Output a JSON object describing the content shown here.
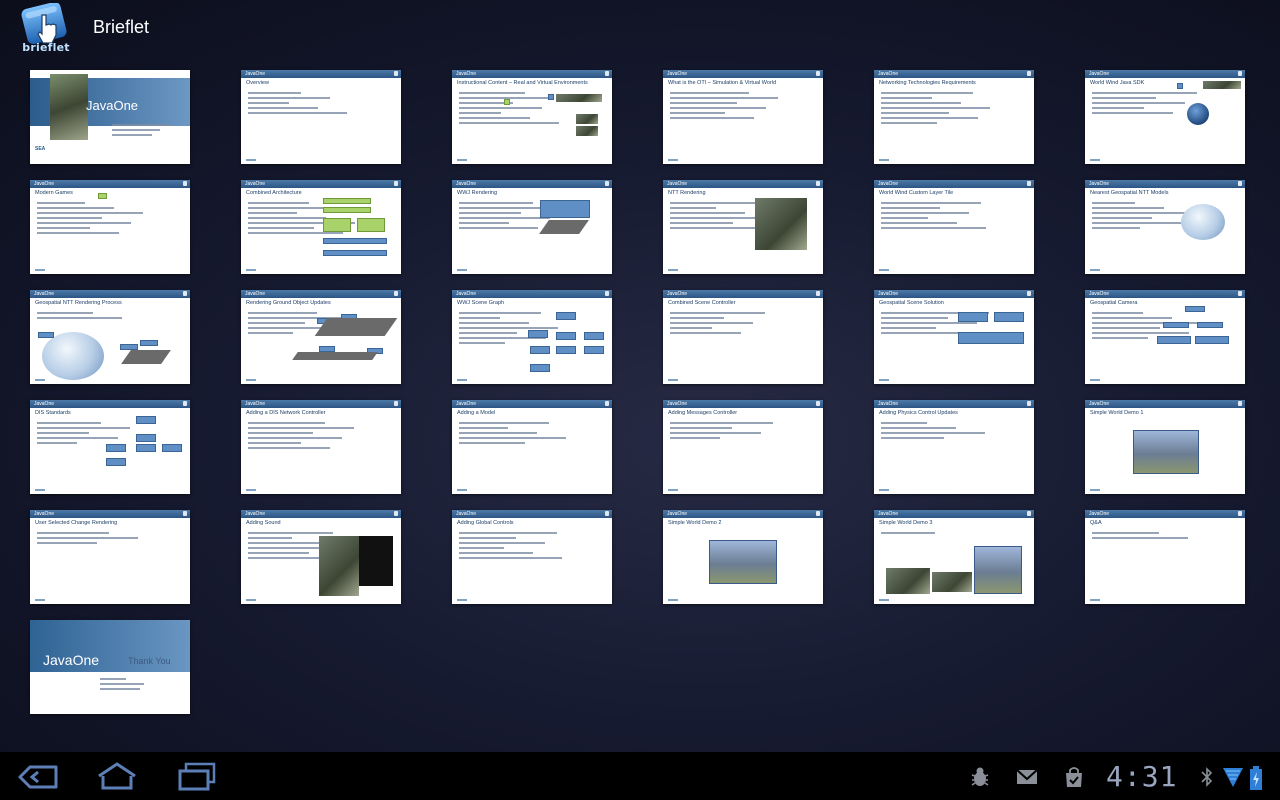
{
  "app": {
    "title": "Brieflet",
    "logo_text": "brieflet",
    "logo_icon": "hand-tap-icon"
  },
  "colors": {
    "slide_header": "#2c5584",
    "title_text": "#1c3d66",
    "background": "#161a30",
    "clock": "#9aa6c0"
  },
  "slides": [
    {
      "kind": "cover",
      "brand": "JavaOne"
    },
    {
      "kind": "content",
      "header": "JavaOne",
      "title": "Overview"
    },
    {
      "kind": "content",
      "header": "JavaOne",
      "title": "Instructional Content – Real and Virtual Environments"
    },
    {
      "kind": "content",
      "header": "JavaOne",
      "title": "What is the OTI – Simulation & Virtual World"
    },
    {
      "kind": "content",
      "header": "JavaOne",
      "title": "Networking Technologies Requirements"
    },
    {
      "kind": "content",
      "header": "JavaOne",
      "title": "World Wind Java SDK"
    },
    {
      "kind": "content",
      "header": "JavaOne",
      "title": "Modern Games"
    },
    {
      "kind": "content",
      "header": "JavaOne",
      "title": "Combined Architecture"
    },
    {
      "kind": "content",
      "header": "JavaOne",
      "title": "WWJ Rendering"
    },
    {
      "kind": "content",
      "header": "JavaOne",
      "title": "NTT Rendering"
    },
    {
      "kind": "content",
      "header": "JavaOne",
      "title": "World Wind Custom Layer Tile"
    },
    {
      "kind": "content",
      "header": "JavaOne",
      "title": "Nearest Geospatial NTT Models"
    },
    {
      "kind": "content",
      "header": "JavaOne",
      "title": "Geospatial NTT Rendering Process"
    },
    {
      "kind": "content",
      "header": "JavaOne",
      "title": "Rendering Ground Object Updates"
    },
    {
      "kind": "content",
      "header": "JavaOne",
      "title": "WWJ Scene Graph"
    },
    {
      "kind": "content",
      "header": "JavaOne",
      "title": "Combined Scene Controller"
    },
    {
      "kind": "content",
      "header": "JavaOne",
      "title": "Geospatial Scene Solution"
    },
    {
      "kind": "content",
      "header": "JavaOne",
      "title": "Geospatial Camera"
    },
    {
      "kind": "content",
      "header": "JavaOne",
      "title": "DIS Standards"
    },
    {
      "kind": "content",
      "header": "JavaOne",
      "title": "Adding a DIS Network Controller"
    },
    {
      "kind": "content",
      "header": "JavaOne",
      "title": "Adding a Model"
    },
    {
      "kind": "content",
      "header": "JavaOne",
      "title": "Adding Messages Controller"
    },
    {
      "kind": "content",
      "header": "JavaOne",
      "title": "Adding Physics Control Updates"
    },
    {
      "kind": "content",
      "header": "JavaOne",
      "title": "Simple World Demo 1"
    },
    {
      "kind": "content",
      "header": "JavaOne",
      "title": "User Selected Change Rendering"
    },
    {
      "kind": "content",
      "header": "JavaOne",
      "title": "Adding Sound"
    },
    {
      "kind": "content",
      "header": "JavaOne",
      "title": "Adding Global Controls"
    },
    {
      "kind": "content",
      "header": "JavaOne",
      "title": "Simple World Demo 2"
    },
    {
      "kind": "content",
      "header": "JavaOne",
      "title": "Simple World Demo 3"
    },
    {
      "kind": "content",
      "header": "JavaOne",
      "title": "Q&A"
    },
    {
      "kind": "final",
      "brand": "JavaOne",
      "thanks": "Thank You"
    }
  ],
  "system_bar": {
    "time": "4:31",
    "nav": [
      "back-icon",
      "home-icon",
      "recent-apps-icon"
    ],
    "status_icons": [
      "debug-bug-icon",
      "gmail-icon",
      "market-bag-icon",
      "bluetooth-icon",
      "wifi-signal-icon",
      "battery-charging-icon"
    ]
  }
}
